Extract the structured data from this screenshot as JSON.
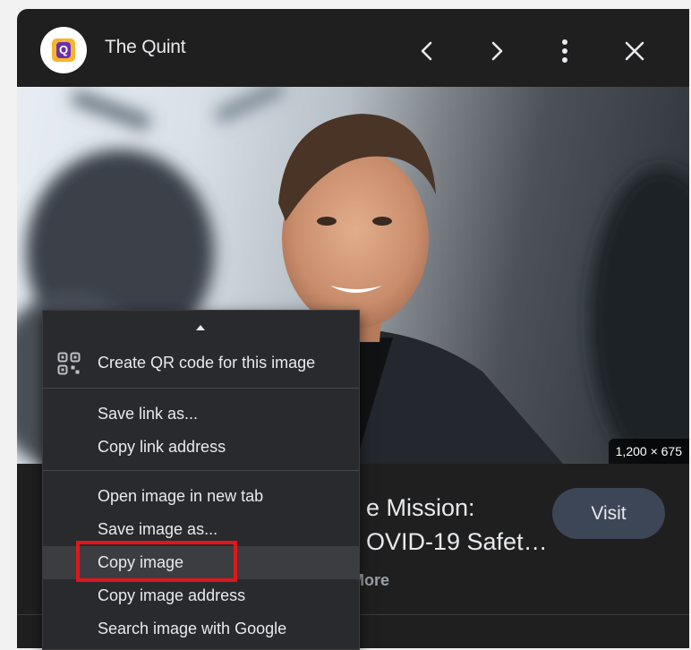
{
  "header": {
    "title": "The Quint",
    "logo_letter": "Q"
  },
  "image": {
    "dimensions": "1,200 × 675"
  },
  "result": {
    "caption_line1": "e Mission:",
    "caption_line2": "OVID-19 Safet…",
    "more": "n More",
    "visit_label": "Visit"
  },
  "menu": {
    "qr": "Create QR code for this image",
    "save_link": "Save link as...",
    "copy_link": "Copy link address",
    "open_image": "Open image in new tab",
    "save_image": "Save image as...",
    "copy_image": "Copy image",
    "copy_image_address": "Copy image address",
    "search_image": "Search image with Google"
  },
  "colors": {
    "panel_bg": "#1f1f1f",
    "menu_bg": "#292a2d",
    "highlight_box": "#e0161c",
    "visit_button": "#3c4656",
    "logo_tile": "#f6b52b",
    "logo_q": "#6b2fb3"
  },
  "icons": [
    "chevron-left-icon",
    "chevron-right-icon",
    "more-vert-icon",
    "close-icon",
    "qr-code-icon",
    "scroll-up-arrow-icon"
  ]
}
